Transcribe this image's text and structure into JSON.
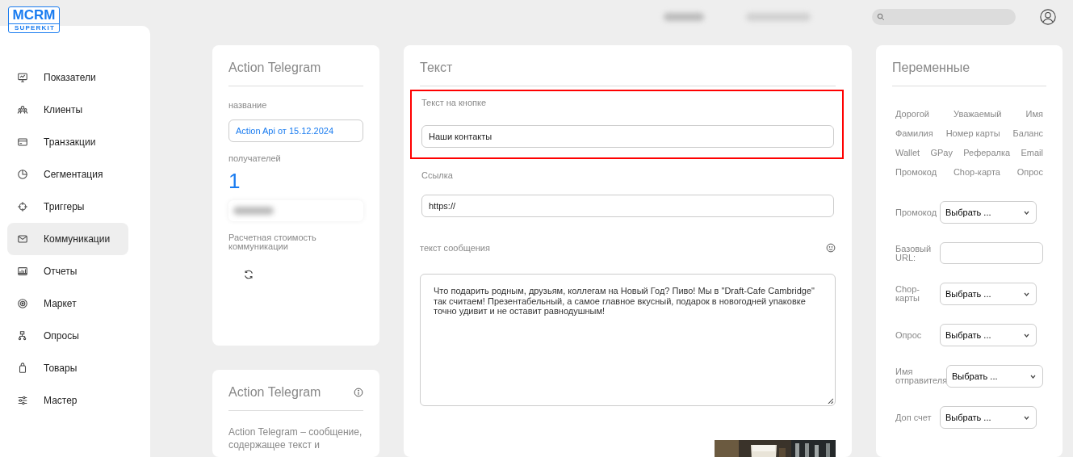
{
  "logo": {
    "title": "MCRM",
    "subtitle": "SUPERKIT"
  },
  "sidebar": {
    "items": [
      {
        "label": "Показатели",
        "selected": false
      },
      {
        "label": "Клиенты",
        "selected": false
      },
      {
        "label": "Транзакции",
        "selected": false
      },
      {
        "label": "Сегментация",
        "selected": false
      },
      {
        "label": "Триггеры",
        "selected": false
      },
      {
        "label": "Коммуникации",
        "selected": true
      },
      {
        "label": "Отчеты",
        "selected": false
      },
      {
        "label": "Маркет",
        "selected": false
      },
      {
        "label": "Опросы",
        "selected": false
      },
      {
        "label": "Товары",
        "selected": false
      },
      {
        "label": "Мастер",
        "selected": false
      }
    ]
  },
  "action_card": {
    "title": "Action Telegram",
    "name_label": "название",
    "name_value": "Action Api от 15.12.2024",
    "recipients_label": "получателей",
    "recipients_count": "1",
    "cost_label": "Расчетная стоимость коммуникации"
  },
  "info_card": {
    "title": "Action Telegram",
    "text": "Action Telegram – сообщение, содержащее текст и"
  },
  "text_card": {
    "title": "Текст",
    "button_text": {
      "label": "Текст на кнопке",
      "value": "Наши контакты",
      "highlighted": true
    },
    "link": {
      "label": "Ссылка",
      "value": "https://",
      "highlighted": false
    },
    "message_label": "текст сообщения",
    "message": "Что подарить родным, друзьям, коллегам на Новый Год? Пиво! Мы в \"Draft-Cafe Cambridge\" так считаем! Презентабельный, а самое главное вкусный, подарок в новогодней упаковке точно удивит и не оставит равнодушным!"
  },
  "variables_card": {
    "title": "Переменные",
    "tag_rows": [
      [
        "Дорогой",
        "Уважаемый",
        "Имя"
      ],
      [
        "Фамилия",
        "Номер карты",
        "Баланс"
      ],
      [
        "Wallet",
        "GPay",
        "Рефералка",
        "Email"
      ],
      [
        "Промокод",
        "Chop-карта",
        "Опрос"
      ]
    ],
    "fields": [
      {
        "label": "Промокод",
        "kind": "select",
        "value": "Выбрать ..."
      },
      {
        "label": "Базовый URL:",
        "kind": "text"
      },
      {
        "label": "Chop-карты",
        "kind": "select",
        "value": "Выбрать ..."
      },
      {
        "label": "Опрос",
        "kind": "select",
        "value": "Выбрать ..."
      },
      {
        "label": "Имя отправителя",
        "kind": "select",
        "value": "Выбрать ..."
      },
      {
        "label": "Доп счет",
        "kind": "select",
        "value": "Выбрать ..."
      }
    ]
  }
}
